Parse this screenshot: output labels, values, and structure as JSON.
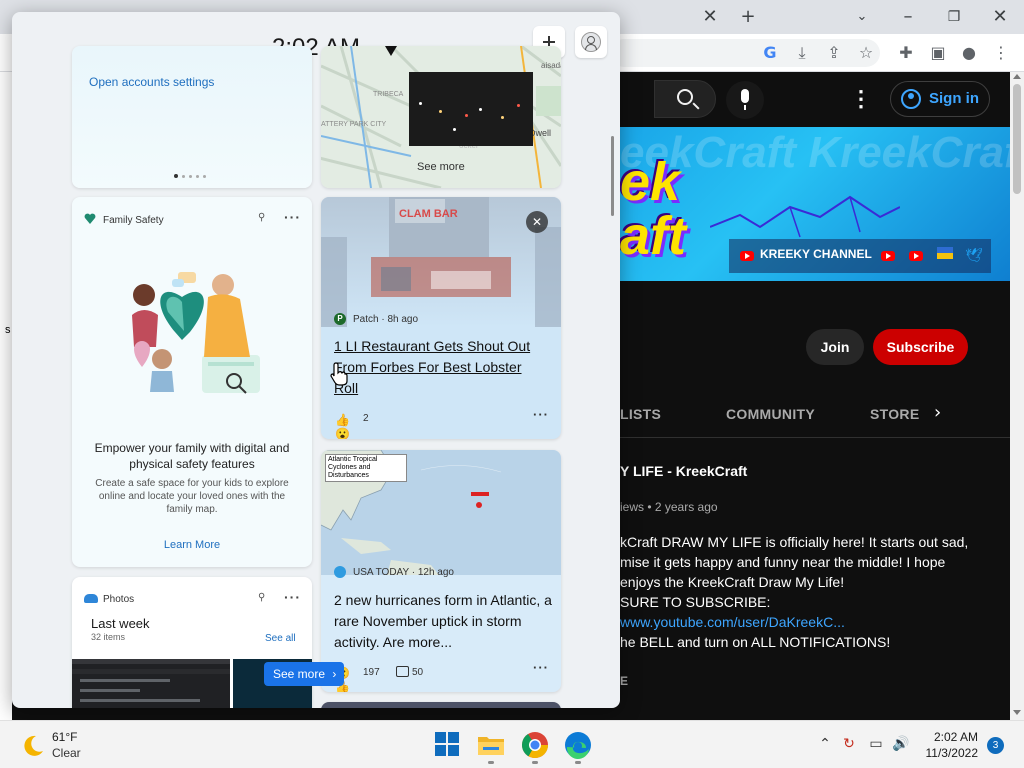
{
  "browser": {
    "signin_label": "Sign in",
    "join_label": "Join",
    "subscribe_label": "Subscribe",
    "banner": {
      "channel_label": "KREEKY CHANNEL",
      "logo_top": "ek",
      "logo_bottom": "aft",
      "bg_text": "eekCraft  KreekCraft  Kr"
    },
    "tabs": [
      "LISTS",
      "COMMUNITY",
      "STORE"
    ],
    "video": {
      "title": "Y LIFE - KreekCraft",
      "meta": "iews • 2 years ago",
      "description": [
        "kCraft DRAW MY LIFE is officially here! It starts out sad,",
        "mise it gets happy and funny near the middle! I hope",
        "enjoys the KreekCraft Draw My Life!",
        " SURE TO SUBSCRIBE:",
        "www.youtube.com/user/DaKreekC...",
        "he BELL and turn on ALL NOTIFICATIONS!"
      ],
      "read_more": "E"
    },
    "left_strip_char": "s",
    "colors": {
      "yt_bg": "#0f0f0f",
      "subscribe": "#cc0000",
      "link": "#3ea6ff"
    }
  },
  "widgets": {
    "clock": "2:02 AM",
    "accounts_card": {
      "link": "Open accounts settings"
    },
    "traffic_card": {
      "see_more": "See more",
      "map_labels": [
        "TRIBECA",
        "ATTERY PARK CITY",
        "Amalgamated Dwell",
        "aisada",
        "ocker"
      ]
    },
    "family_safety": {
      "title": "Family Safety",
      "headline": "Empower your family with digital and physical safety features",
      "body": "Create a safe space for your kids to explore online and locate your loved ones with the family map.",
      "learn_more": "Learn More"
    },
    "photos": {
      "title": "Photos",
      "period": "Last week",
      "count": "32 items",
      "see_all": "See all",
      "see_more_button": "See more"
    },
    "news": [
      {
        "source": "Patch · 8h ago",
        "source_initial": "P",
        "headline": "1 LI Restaurant Gets Shout Out From Forbes For Best Lobster Roll",
        "reactions": "2",
        "sign_text": "CLAM BAR"
      },
      {
        "source": "USA TODAY · 12h ago",
        "headline": "2 new hurricanes form in Atlantic, a rare November uptick in storm activity. Are more...",
        "reactions": "197",
        "comments": "50",
        "map_label": "Atlantic Tropical Cyclones and Disturbances"
      }
    ]
  },
  "taskbar": {
    "weather_temp": "61°F",
    "weather_condition": "Clear",
    "time": "2:02 AM",
    "date": "11/3/2022",
    "notification_count": "3",
    "icons": [
      "start-icon",
      "file-explorer-icon",
      "chrome-icon",
      "edge-icon"
    ],
    "tray_icons": [
      "chevron-up-icon",
      "update-icon",
      "network-icon",
      "volume-icon"
    ]
  }
}
